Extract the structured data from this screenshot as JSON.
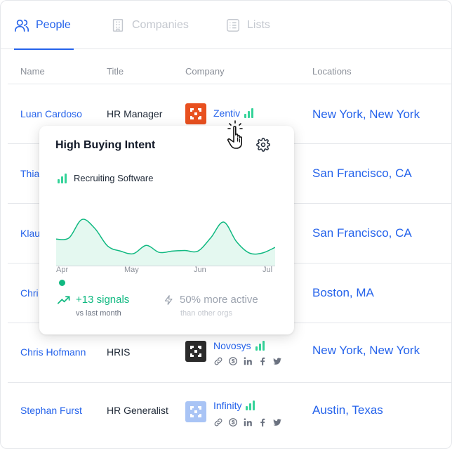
{
  "tabs": [
    {
      "label": "People",
      "icon": "people-icon",
      "active": true
    },
    {
      "label": "Companies",
      "icon": "building-icon",
      "active": false
    },
    {
      "label": "Lists",
      "icon": "list-icon",
      "active": false
    }
  ],
  "table": {
    "headers": [
      "Name",
      "Title",
      "Company",
      "Locations"
    ],
    "rows": [
      {
        "name": "Luan Cardoso",
        "title": "HR Manager",
        "company": "Zentiv",
        "location": "New York, New York"
      },
      {
        "name": "Thia",
        "title": "",
        "company": "",
        "location": "San Francisco, CA"
      },
      {
        "name": "Klau",
        "title": "",
        "company": "",
        "location": "San Francisco, CA"
      },
      {
        "name": "Chri",
        "title": "",
        "company": "",
        "location": "Boston, MA"
      },
      {
        "name": "Chris Hofmann",
        "title": "HRIS",
        "company": "Novosys",
        "location": "New York, New York"
      },
      {
        "name": "Stephan Furst",
        "title": "HR Generalist",
        "company": "Infinity",
        "location": "Austin, Texas"
      }
    ]
  },
  "popover": {
    "title": "High Buying Intent",
    "topic": "Recruiting Software",
    "signals": "+13 signals",
    "signals_sub": "vs last month",
    "activity": "50% more active",
    "activity_sub": "than other orgs"
  },
  "chart_data": {
    "type": "area",
    "x_labels": [
      "Apr",
      "May",
      "Jun",
      "Jul"
    ],
    "series": [
      {
        "values": [
          43,
          45,
          74,
          60,
          32,
          24,
          20,
          33,
          22,
          24,
          25,
          24,
          45,
          70,
          39,
          21,
          21,
          30
        ]
      }
    ],
    "ylim": [
      0,
      100
    ]
  },
  "colors": {
    "accent": "#2563eb",
    "signal": "#10b981",
    "zentiv_logo": "#e8501f",
    "novosys_logo": "#2b2b2b",
    "infinity_logo": "#a9c4f5"
  }
}
